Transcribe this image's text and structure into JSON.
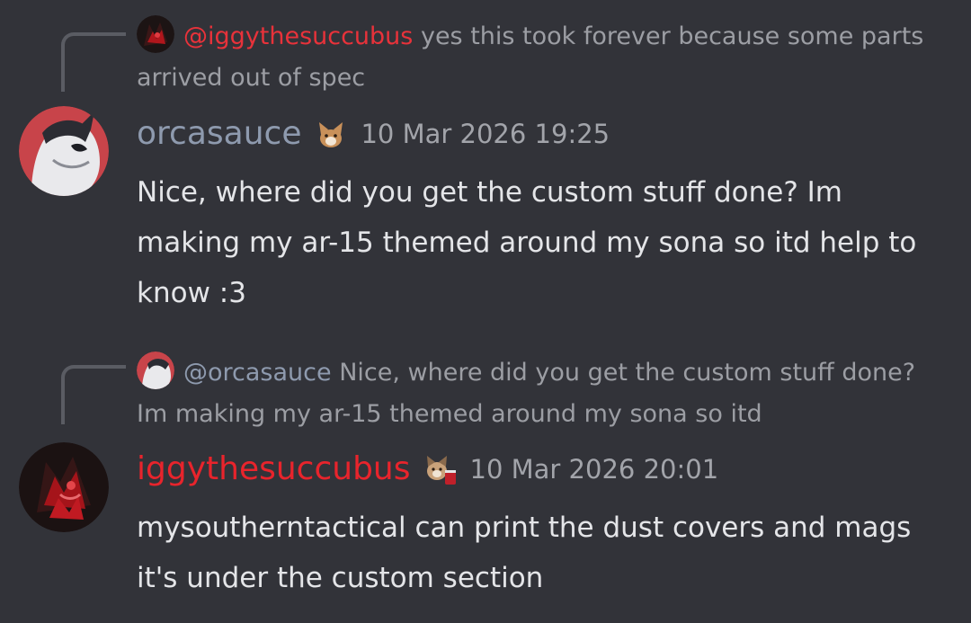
{
  "messages": [
    {
      "reply": {
        "mention": "@iggythesuccubus",
        "text": "yes this took forever because some parts arrived out of spec",
        "avatar_icon": "dark-red-character-avatar-icon"
      },
      "author": {
        "name": "orcasauce",
        "color": "#8e9aae",
        "avatar_icon": "white-orca-character-avatar-icon",
        "badge_icon": "pet-emoji-badge-icon"
      },
      "timestamp": "10 Mar 2026 19:25",
      "content": "Nice, where did you get the custom stuff done? Im making my ar-15 themed around my sona so itd help to know :3"
    },
    {
      "reply": {
        "mention": "@orcasauce",
        "text": "Nice, where did you get the custom stuff done? Im making my ar-15 themed around my sona so itd",
        "avatar_icon": "white-orca-character-avatar-icon"
      },
      "author": {
        "name": "iggythesuccubus",
        "color": "#e8242c",
        "avatar_icon": "dark-red-character-avatar-icon",
        "badge_icon": "pet-with-red-cup-badge-icon"
      },
      "timestamp": "10 Mar 2026 20:01",
      "content": "mysoutherntactical can print the dust covers and mags it's under the custom section"
    }
  ]
}
